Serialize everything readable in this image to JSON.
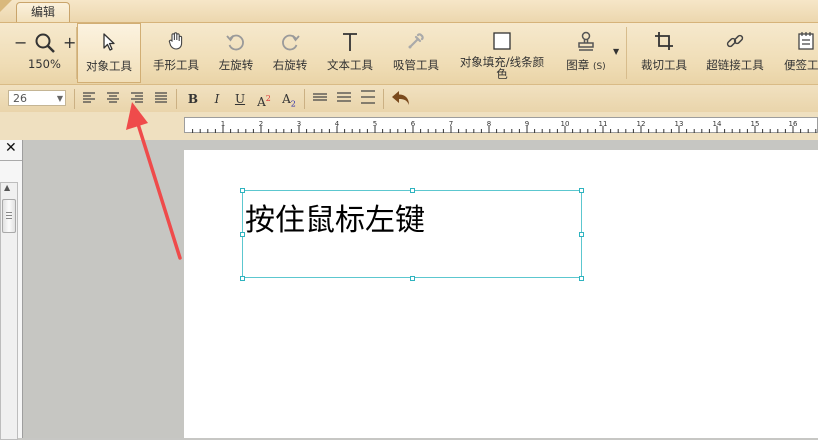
{
  "tab": {
    "label": "编辑"
  },
  "zoom": {
    "value": "150%",
    "minus": "−",
    "plus": "+"
  },
  "toolbar": {
    "object_tool": "对象工具",
    "hand_tool": "手形工具",
    "rotate_left": "左旋转",
    "rotate_right": "右旋转",
    "text_tool": "文本工具",
    "eyedropper_tool": "吸管工具",
    "fill_color": "对象填充/线条颜色",
    "stamp": "图章",
    "stamp_shortcut": "(S)",
    "crop_tool": "裁切工具",
    "link_tool": "超链接工具",
    "note_tool": "便签工"
  },
  "format": {
    "font_size": "26",
    "bold": "B",
    "italic": "I",
    "underline": "U",
    "superscript": "A",
    "superscript_mark": "2",
    "subscript": "A",
    "subscript_mark": "2"
  },
  "ruler": {
    "labels": [
      "1",
      "2",
      "3",
      "4",
      "5",
      "6",
      "7",
      "8",
      "9",
      "10",
      "11",
      "12",
      "13",
      "14",
      "15",
      "16"
    ]
  },
  "panel": {
    "close": "✕"
  },
  "document": {
    "text": "按住鼠标左键"
  },
  "colors": {
    "ribbon": "#efdcb4",
    "selection": "#2fb3bf",
    "annotation_arrow": "#ef4b4b"
  }
}
